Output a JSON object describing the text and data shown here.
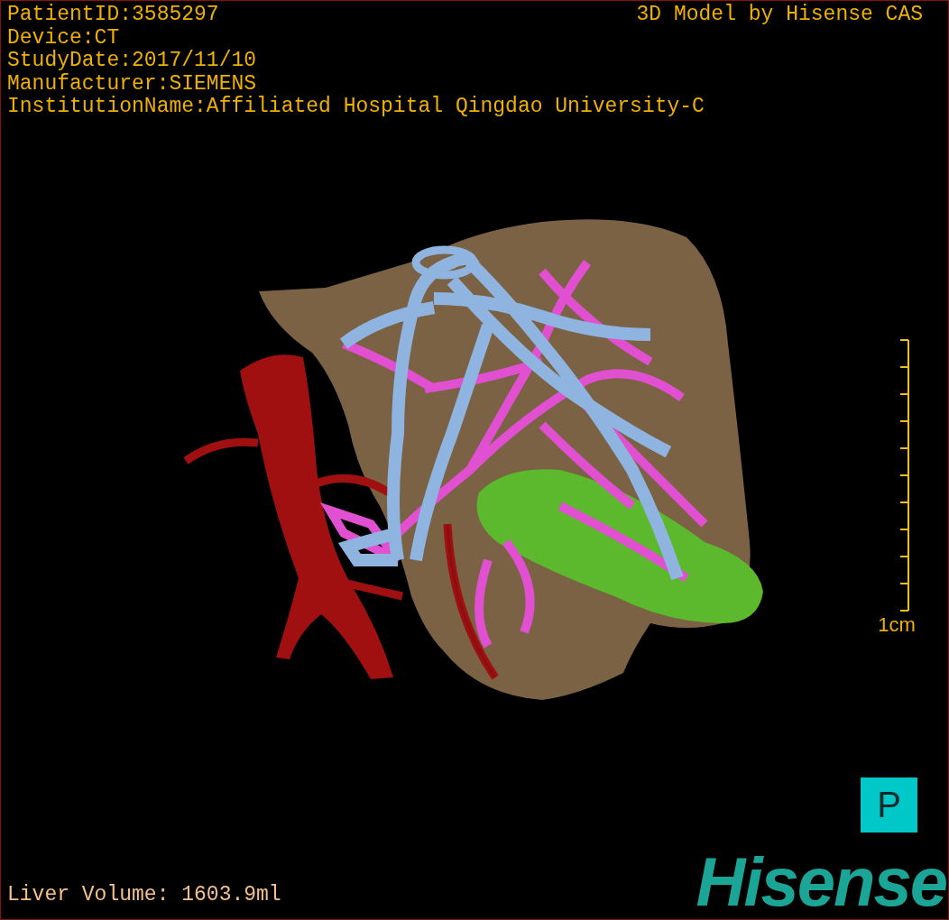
{
  "study_info": [
    "PatientID:3585297",
    "Device:CT",
    "StudyDate:2017/11/10",
    "Manufacturer:SIEMENS",
    "InstitutionName:Affiliated Hospital Qingdao University-C"
  ],
  "model_title": "3D Model by Hisense CAS",
  "scale_bar": {
    "label": "1cm"
  },
  "orientation_button": {
    "label": "P"
  },
  "liver_volume": "Liver Volume: 1603.9ml",
  "logo": "Hisense"
}
